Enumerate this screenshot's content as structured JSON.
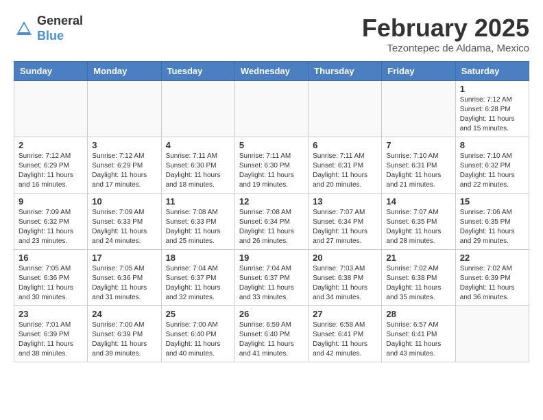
{
  "header": {
    "logo_general": "General",
    "logo_blue": "Blue",
    "month_title": "February 2025",
    "location": "Tezontepec de Aldama, Mexico"
  },
  "days_of_week": [
    "Sunday",
    "Monday",
    "Tuesday",
    "Wednesday",
    "Thursday",
    "Friday",
    "Saturday"
  ],
  "weeks": [
    [
      {
        "day": "",
        "info": ""
      },
      {
        "day": "",
        "info": ""
      },
      {
        "day": "",
        "info": ""
      },
      {
        "day": "",
        "info": ""
      },
      {
        "day": "",
        "info": ""
      },
      {
        "day": "",
        "info": ""
      },
      {
        "day": "1",
        "info": "Sunrise: 7:12 AM\nSunset: 6:28 PM\nDaylight: 11 hours\nand 15 minutes."
      }
    ],
    [
      {
        "day": "2",
        "info": "Sunrise: 7:12 AM\nSunset: 6:29 PM\nDaylight: 11 hours\nand 16 minutes."
      },
      {
        "day": "3",
        "info": "Sunrise: 7:12 AM\nSunset: 6:29 PM\nDaylight: 11 hours\nand 17 minutes."
      },
      {
        "day": "4",
        "info": "Sunrise: 7:11 AM\nSunset: 6:30 PM\nDaylight: 11 hours\nand 18 minutes."
      },
      {
        "day": "5",
        "info": "Sunrise: 7:11 AM\nSunset: 6:30 PM\nDaylight: 11 hours\nand 19 minutes."
      },
      {
        "day": "6",
        "info": "Sunrise: 7:11 AM\nSunset: 6:31 PM\nDaylight: 11 hours\nand 20 minutes."
      },
      {
        "day": "7",
        "info": "Sunrise: 7:10 AM\nSunset: 6:31 PM\nDaylight: 11 hours\nand 21 minutes."
      },
      {
        "day": "8",
        "info": "Sunrise: 7:10 AM\nSunset: 6:32 PM\nDaylight: 11 hours\nand 22 minutes."
      }
    ],
    [
      {
        "day": "9",
        "info": "Sunrise: 7:09 AM\nSunset: 6:32 PM\nDaylight: 11 hours\nand 23 minutes."
      },
      {
        "day": "10",
        "info": "Sunrise: 7:09 AM\nSunset: 6:33 PM\nDaylight: 11 hours\nand 24 minutes."
      },
      {
        "day": "11",
        "info": "Sunrise: 7:08 AM\nSunset: 6:33 PM\nDaylight: 11 hours\nand 25 minutes."
      },
      {
        "day": "12",
        "info": "Sunrise: 7:08 AM\nSunset: 6:34 PM\nDaylight: 11 hours\nand 26 minutes."
      },
      {
        "day": "13",
        "info": "Sunrise: 7:07 AM\nSunset: 6:34 PM\nDaylight: 11 hours\nand 27 minutes."
      },
      {
        "day": "14",
        "info": "Sunrise: 7:07 AM\nSunset: 6:35 PM\nDaylight: 11 hours\nand 28 minutes."
      },
      {
        "day": "15",
        "info": "Sunrise: 7:06 AM\nSunset: 6:35 PM\nDaylight: 11 hours\nand 29 minutes."
      }
    ],
    [
      {
        "day": "16",
        "info": "Sunrise: 7:05 AM\nSunset: 6:36 PM\nDaylight: 11 hours\nand 30 minutes."
      },
      {
        "day": "17",
        "info": "Sunrise: 7:05 AM\nSunset: 6:36 PM\nDaylight: 11 hours\nand 31 minutes."
      },
      {
        "day": "18",
        "info": "Sunrise: 7:04 AM\nSunset: 6:37 PM\nDaylight: 11 hours\nand 32 minutes."
      },
      {
        "day": "19",
        "info": "Sunrise: 7:04 AM\nSunset: 6:37 PM\nDaylight: 11 hours\nand 33 minutes."
      },
      {
        "day": "20",
        "info": "Sunrise: 7:03 AM\nSunset: 6:38 PM\nDaylight: 11 hours\nand 34 minutes."
      },
      {
        "day": "21",
        "info": "Sunrise: 7:02 AM\nSunset: 6:38 PM\nDaylight: 11 hours\nand 35 minutes."
      },
      {
        "day": "22",
        "info": "Sunrise: 7:02 AM\nSunset: 6:39 PM\nDaylight: 11 hours\nand 36 minutes."
      }
    ],
    [
      {
        "day": "23",
        "info": "Sunrise: 7:01 AM\nSunset: 6:39 PM\nDaylight: 11 hours\nand 38 minutes."
      },
      {
        "day": "24",
        "info": "Sunrise: 7:00 AM\nSunset: 6:39 PM\nDaylight: 11 hours\nand 39 minutes."
      },
      {
        "day": "25",
        "info": "Sunrise: 7:00 AM\nSunset: 6:40 PM\nDaylight: 11 hours\nand 40 minutes."
      },
      {
        "day": "26",
        "info": "Sunrise: 6:59 AM\nSunset: 6:40 PM\nDaylight: 11 hours\nand 41 minutes."
      },
      {
        "day": "27",
        "info": "Sunrise: 6:58 AM\nSunset: 6:41 PM\nDaylight: 11 hours\nand 42 minutes."
      },
      {
        "day": "28",
        "info": "Sunrise: 6:57 AM\nSunset: 6:41 PM\nDaylight: 11 hours\nand 43 minutes."
      },
      {
        "day": "",
        "info": ""
      }
    ]
  ]
}
